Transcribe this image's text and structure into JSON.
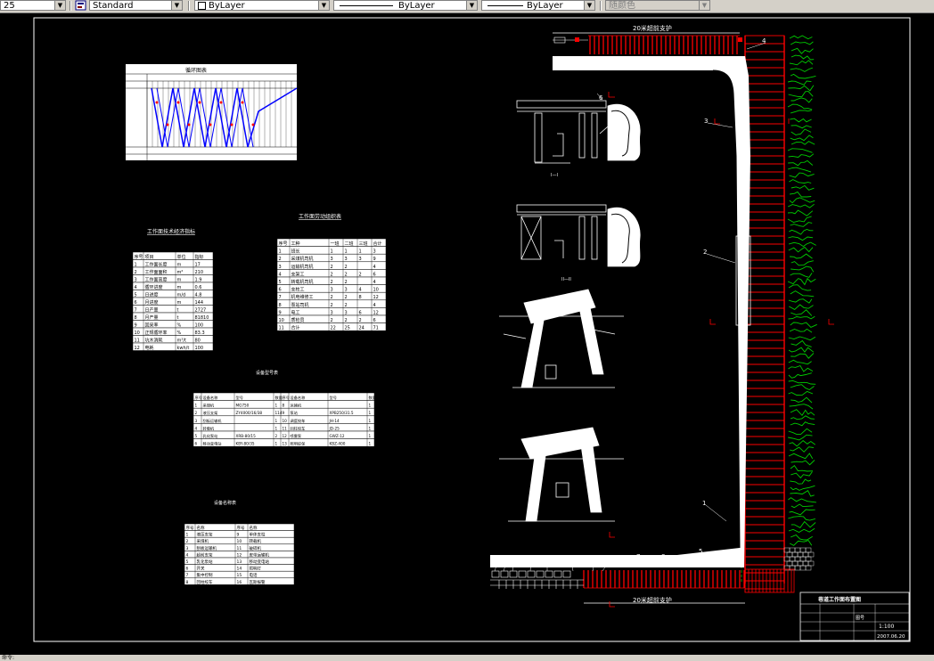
{
  "toolbar": {
    "layer_value": "25",
    "textstyle_value": "Standard",
    "color_value": "ByLayer",
    "linetype_value": "ByLayer",
    "lineweight_value": "ByLayer",
    "plotstyle_value": "随颜色"
  },
  "status": {
    "text": "命令:"
  },
  "drawing": {
    "colors": {
      "background": "#000000",
      "line": "#ffffff",
      "support": "#ff0000",
      "rock": "#00cc00",
      "chart_line": "#0000ff",
      "chart_mark": "#ff0000"
    },
    "top_label": "20米超前支护",
    "bottom_label": "20米超前支护",
    "section_labels": [
      "I—I",
      "II—II"
    ],
    "callouts": [
      "1",
      "2",
      "3",
      "4",
      "5",
      "6",
      "7",
      "8",
      "9",
      "10",
      "11",
      "12",
      "13",
      "14",
      "15",
      "16"
    ],
    "title_block": {
      "title": "巷道工作面布置图",
      "scale": "1:100",
      "date": "2007.06.20",
      "drawing_no": "图号"
    }
  },
  "tables": {
    "cycle": {
      "title": "循环图表"
    },
    "tech": {
      "title": "工作面技术经济指标",
      "headers": [
        "序号",
        "项目",
        "单位",
        "指标"
      ],
      "rows": [
        [
          "1",
          "工作面长度",
          "m",
          "17"
        ],
        [
          "2",
          "工作面面积",
          "m²",
          "210"
        ],
        [
          "3",
          "工作面高度",
          "m",
          "1.9"
        ],
        [
          "4",
          "循环进度",
          "m",
          "0.6"
        ],
        [
          "5",
          "日进度",
          "m/d",
          "4.8"
        ],
        [
          "6",
          "月进度",
          "m",
          "144"
        ],
        [
          "7",
          "日产量",
          "t",
          "2727"
        ],
        [
          "8",
          "月产量",
          "t",
          "81810"
        ],
        [
          "9",
          "回采率",
          "%",
          "100"
        ],
        [
          "10",
          "正规循环率",
          "%",
          "83.3"
        ],
        [
          "11",
          "坑木消耗",
          "m³/t",
          "80"
        ],
        [
          "12",
          "电耗",
          "kwh/t",
          "100"
        ]
      ]
    },
    "labor": {
      "title": "工作面劳动组织表",
      "headers": [
        "序号",
        "工种",
        "一班",
        "二班",
        "三班",
        "合计"
      ],
      "rows": [
        [
          "1",
          "班长",
          "1",
          "1",
          "1",
          "3"
        ],
        [
          "2",
          "采煤机司机",
          "3",
          "3",
          "3",
          "9"
        ],
        [
          "3",
          "运输机司机",
          "2",
          "2",
          "",
          "4"
        ],
        [
          "4",
          "支架工",
          "2",
          "2",
          "2",
          "6"
        ],
        [
          "5",
          "转载机司机",
          "2",
          "2",
          "",
          "4"
        ],
        [
          "6",
          "支柱工",
          "3",
          "3",
          "4",
          "10"
        ],
        [
          "7",
          "机电维修工",
          "2",
          "2",
          "8",
          "12"
        ],
        [
          "8",
          "泵站司机",
          "2",
          "2",
          "",
          "4"
        ],
        [
          "9",
          "电工",
          "3",
          "3",
          "6",
          "12"
        ],
        [
          "10",
          "质检员",
          "2",
          "2",
          "2",
          "6"
        ],
        [
          "11",
          "合计",
          "22",
          "25",
          "24",
          "71"
        ]
      ]
    },
    "equipment": {
      "title": "设备型号表",
      "headers": [
        "序号",
        "设备名称",
        "型号",
        "数量",
        "序号",
        "设备名称",
        "型号",
        "数量"
      ],
      "rows": [
        [
          "1",
          "采煤机",
          "MG750",
          "1",
          "8",
          "运输机",
          "",
          "1"
        ],
        [
          "2",
          "液压支架",
          "ZY4000/16/38",
          "114",
          "9",
          "泵站",
          "XPB250/31.5",
          "1"
        ],
        [
          "3",
          "刮板运输机",
          "",
          "1",
          "10",
          "调度绞车",
          "JH-14",
          "1"
        ],
        [
          "4",
          "转载机",
          "",
          "1",
          "11",
          "回柱绞车",
          "JD-25",
          "1"
        ],
        [
          "5",
          "乳化泵站",
          "XRB-80/15",
          "2",
          "12",
          "喷雾泵",
          "GWZ-12",
          "1"
        ],
        [
          "6",
          "移动变电站",
          "KBY-80/35",
          "1",
          "13",
          "照明综保",
          "KBZ-400",
          "1"
        ]
      ]
    },
    "legend": {
      "title": "设备名称表",
      "headers": [
        "序号",
        "名称",
        "序号",
        "名称"
      ],
      "rows": [
        [
          "1",
          "液压支架",
          "9",
          "单体支柱"
        ],
        [
          "2",
          "采煤机",
          "10",
          "转载机"
        ],
        [
          "3",
          "刮板运输机",
          "11",
          "破碎机"
        ],
        [
          "4",
          "超前支架",
          "12",
          "皮带运输机"
        ],
        [
          "5",
          "乳化泵站",
          "13",
          "移动变电站"
        ],
        [
          "6",
          "开关",
          "14",
          "照明灯"
        ],
        [
          "7",
          "集中控制",
          "15",
          "电话"
        ],
        [
          "8",
          "回柱绞车",
          "16",
          "瓦斯报警"
        ]
      ]
    }
  }
}
